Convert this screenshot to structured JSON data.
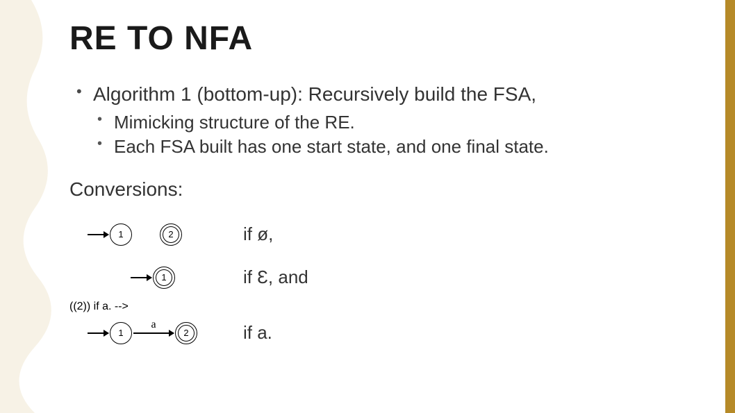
{
  "title": "RE TO NFA",
  "bullets": {
    "main": "Algorithm 1 (bottom-up):  Recursively build the FSA,",
    "sub1": "Mimicking structure of the RE.",
    "sub2": "Each FSA built has one start state, and one final state."
  },
  "conversions_label": "Conversions:",
  "rows": {
    "r1": {
      "s1": "1",
      "s2": "2",
      "desc": "if ø,"
    },
    "r2": {
      "s1": "1",
      "desc": "if Ɛ, and"
    },
    "r3": {
      "s1": "1",
      "edge": "a",
      "s2": "2",
      "desc": "if a."
    }
  }
}
